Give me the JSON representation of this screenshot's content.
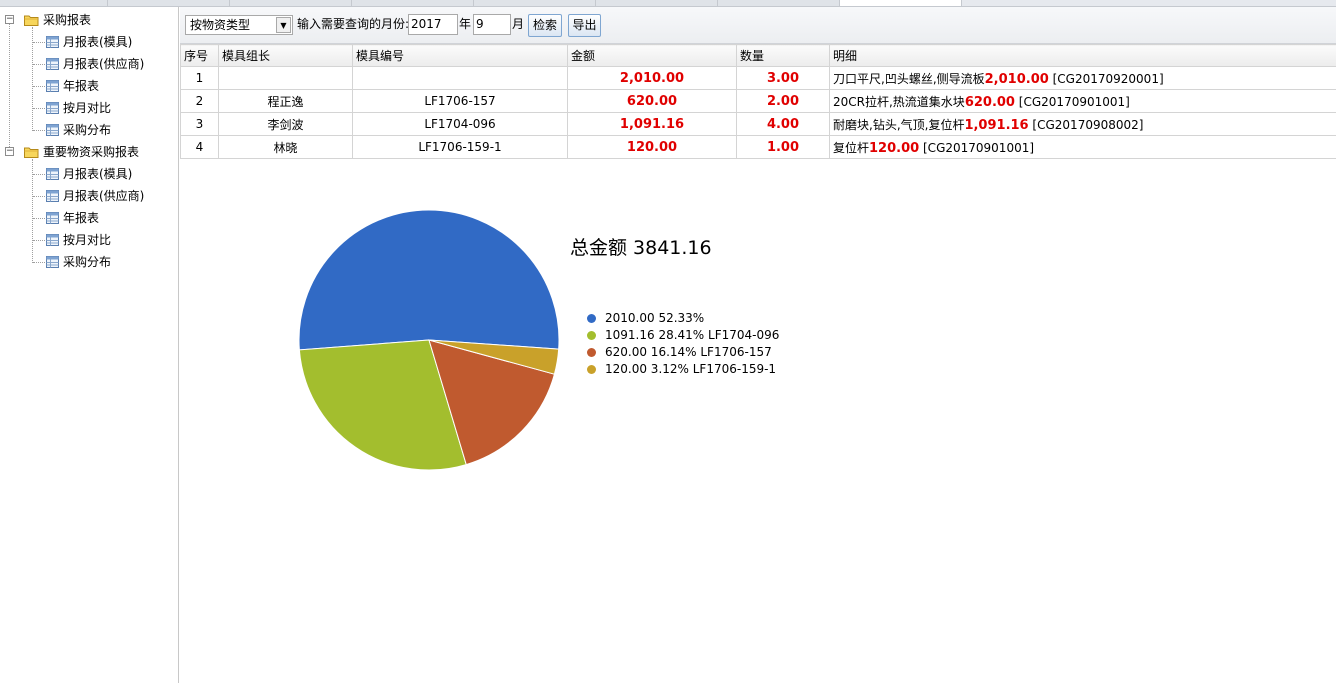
{
  "sidebar": {
    "groups": [
      {
        "label": "采购报表",
        "items": [
          "月报表(模具)",
          "月报表(供应商)",
          "年报表",
          "按月对比",
          "采购分布"
        ]
      },
      {
        "label": "重要物资采购报表",
        "items": [
          "月报表(模具)",
          "月报表(供应商)",
          "年报表",
          "按月对比",
          "采购分布"
        ]
      }
    ]
  },
  "toolbar": {
    "type_select_value": "按物资类型",
    "month_prompt": "输入需要查询的月份:",
    "year_value": "2017",
    "year_unit": "年",
    "month_value": "9",
    "month_unit": "月",
    "search_label": "检索",
    "export_label": "导出"
  },
  "table": {
    "headers": [
      "序号",
      "模具组长",
      "模具编号",
      "金额",
      "数量",
      "明细"
    ],
    "rows": [
      {
        "no": "1",
        "leader": "",
        "code": "",
        "amount": "2,010.00",
        "qty": "3.00",
        "detail_prefix": "刀口平尺,凹头螺丝,侧导流板",
        "detail_amount": "2,010.00",
        "detail_suffix": " [CG20170920001]"
      },
      {
        "no": "2",
        "leader": "程正逸",
        "code": "LF1706-157",
        "amount": "620.00",
        "qty": "2.00",
        "detail_prefix": "20CR拉杆,热流道集水块",
        "detail_amount": "620.00",
        "detail_suffix": " [CG20170901001]"
      },
      {
        "no": "3",
        "leader": "李剑波",
        "code": "LF1704-096",
        "amount": "1,091.16",
        "qty": "4.00",
        "detail_prefix": "耐磨块,钻头,气顶,复位杆",
        "detail_amount": "1,091.16",
        "detail_suffix": " [CG20170908002]"
      },
      {
        "no": "4",
        "leader": "林晓",
        "code": "LF1706-159-1",
        "amount": "120.00",
        "qty": "1.00",
        "detail_prefix": "复位杆",
        "detail_amount": "120.00",
        "detail_suffix": " [CG20170901001]"
      }
    ]
  },
  "chart_data": {
    "type": "pie",
    "title": "总金额 3841.16",
    "legend_position": "right",
    "slices": [
      {
        "label": "2010.00 52.33%",
        "value": 2010.0,
        "color": "#316ac5"
      },
      {
        "label": "1091.16 28.41% LF1704-096",
        "value": 1091.16,
        "color": "#a3be2e"
      },
      {
        "label": "620.00 16.14% LF1706-157",
        "value": 620.0,
        "color": "#c05a2f"
      },
      {
        "label": "120.00 3.12% LF1706-159-1",
        "value": 120.0,
        "color": "#c9a12a"
      }
    ]
  }
}
